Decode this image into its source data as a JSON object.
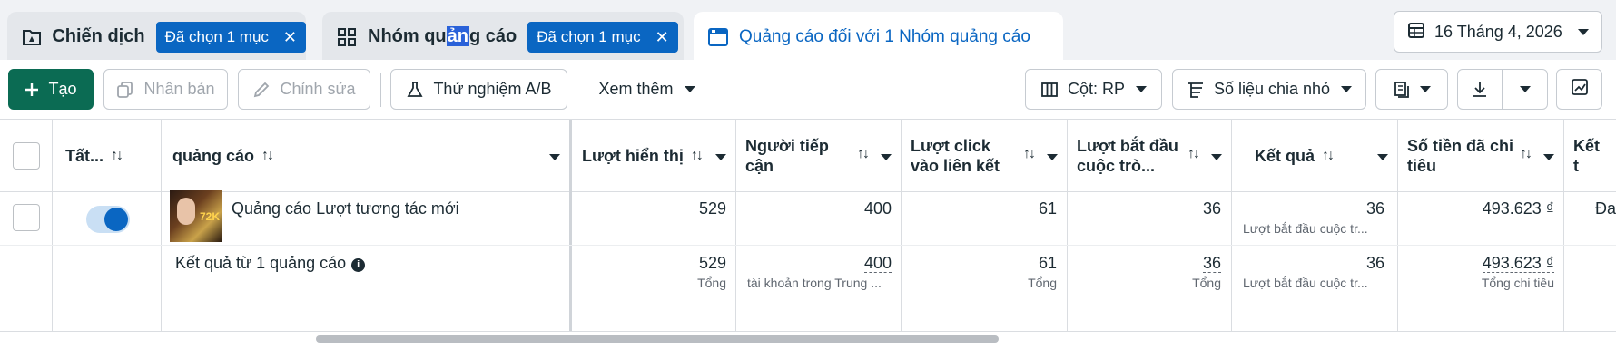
{
  "tabs": {
    "campaign": {
      "label": "Chiến dịch",
      "chip": "Đã chọn 1 mục"
    },
    "adset": {
      "label_pre": "Nhóm qu",
      "label_sel": "ản",
      "label_post": "g cáo",
      "chip": "Đã chọn 1 mục"
    },
    "ads": {
      "label": "Quảng cáo đối với 1 Nhóm quảng cáo"
    }
  },
  "date_range": {
    "label": "16 Tháng 4, 2026"
  },
  "toolbar": {
    "create": "Tạo",
    "duplicate": "Nhân bản",
    "edit": "Chỉnh sửa",
    "ab_test": "Thử nghiệm A/B",
    "more": "Xem thêm",
    "columns": "Cột: RP",
    "breakdown": "Số liệu chia nhỏ"
  },
  "table": {
    "columns": {
      "toggle": "Tất...",
      "ad": "quảng cáo",
      "impressions": "Lượt hiển thị",
      "reach_l1": "Người tiếp",
      "reach_l2": "cận",
      "clicks_l1": "Lượt click",
      "clicks_l2": "vào liên kết",
      "conv_l1": "Lượt bắt đầu",
      "conv_l2": "cuộc trò...",
      "results": "Kết quả",
      "spend_l1": "Số tiền đã chi",
      "spend_l2": "tiêu",
      "cpr": "Kết t"
    },
    "row": {
      "name": "Quảng cáo Lượt tương tác mới",
      "thumb_text": "72K",
      "impressions": "529",
      "reach": "400",
      "clicks": "61",
      "conv": "36",
      "results": "36",
      "results_sub": "Lượt bắt đầu cuộc tr...",
      "spend": "493.623 ₫",
      "cpr": "Đa"
    },
    "summary": {
      "label": "Kết quả từ 1 quảng cáo",
      "impressions": "529",
      "impressions_sub": "Tổng",
      "reach": "400",
      "reach_sub": "tài khoản trong Trung ...",
      "clicks": "61",
      "clicks_sub": "Tổng",
      "conv": "36",
      "conv_sub": "Tổng",
      "results": "36",
      "results_sub": "Lượt bắt đầu cuộc tr...",
      "spend": "493.623 ₫",
      "spend_sub": "Tổng chi tiêu"
    }
  },
  "colors": {
    "primary": "#0b6b53",
    "accent": "#0a66c2"
  }
}
